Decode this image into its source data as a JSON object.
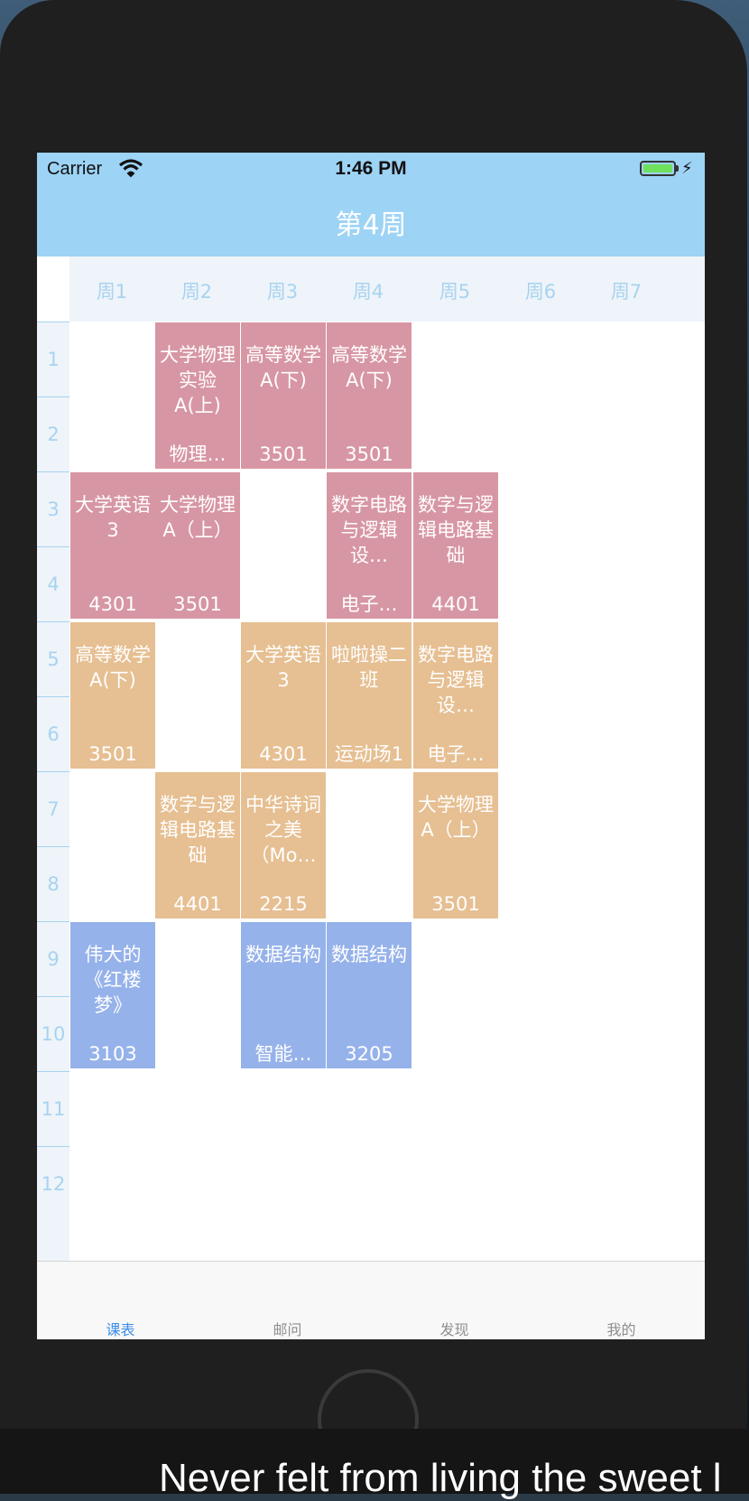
{
  "status_bar": {
    "carrier": "Carrier",
    "time": "1:46 PM"
  },
  "header": {
    "title": "第4周"
  },
  "days": [
    "周1",
    "周2",
    "周3",
    "周4",
    "周5",
    "周6",
    "周7"
  ],
  "periods": [
    "1",
    "2",
    "3",
    "4",
    "5",
    "6",
    "7",
    "8",
    "9",
    "10",
    "11",
    "12"
  ],
  "courses": [
    {
      "name": "大学物理实验A(上)",
      "room": "物理…",
      "day": 2,
      "start": 1,
      "span": 2,
      "color": "pink"
    },
    {
      "name": "高等数学A(下)",
      "room": "3501",
      "day": 3,
      "start": 1,
      "span": 2,
      "color": "pink"
    },
    {
      "name": "高等数学A(下)",
      "room": "3501",
      "day": 4,
      "start": 1,
      "span": 2,
      "color": "pink"
    },
    {
      "name": "大学英语3",
      "room": "4301",
      "day": 1,
      "start": 3,
      "span": 2,
      "color": "pink"
    },
    {
      "name": "大学物理A（上）",
      "room": "3501",
      "day": 2,
      "start": 3,
      "span": 2,
      "color": "pink"
    },
    {
      "name": "数字电路与逻辑设…",
      "room": "电子…",
      "day": 4,
      "start": 3,
      "span": 2,
      "color": "pink"
    },
    {
      "name": "数字与逻辑电路基础",
      "room": "4401",
      "day": 5,
      "start": 3,
      "span": 2,
      "color": "pink"
    },
    {
      "name": "高等数学A(下)",
      "room": "3501",
      "day": 1,
      "start": 5,
      "span": 2,
      "color": "orange"
    },
    {
      "name": "大学英语3",
      "room": "4301",
      "day": 3,
      "start": 5,
      "span": 2,
      "color": "orange"
    },
    {
      "name": "啦啦操二班",
      "room": "运动场1",
      "day": 4,
      "start": 5,
      "span": 2,
      "color": "orange"
    },
    {
      "name": "数字电路与逻辑设…",
      "room": "电子…",
      "day": 5,
      "start": 5,
      "span": 2,
      "color": "orange"
    },
    {
      "name": "数字与逻辑电路基础",
      "room": "4401",
      "day": 2,
      "start": 7,
      "span": 2,
      "color": "orange"
    },
    {
      "name": "中华诗词之美（Mo…",
      "room": "2215",
      "day": 3,
      "start": 7,
      "span": 2,
      "color": "orange"
    },
    {
      "name": "大学物理A（上）",
      "room": "3501",
      "day": 5,
      "start": 7,
      "span": 2,
      "color": "orange"
    },
    {
      "name": "伟大的《红楼梦》",
      "room": "3103",
      "day": 1,
      "start": 9,
      "span": 2,
      "color": "blue"
    },
    {
      "name": "数据结构",
      "room": "智能…",
      "day": 3,
      "start": 9,
      "span": 2,
      "color": "blue"
    },
    {
      "name": "数据结构",
      "room": "3205",
      "day": 4,
      "start": 9,
      "span": 2,
      "color": "blue"
    }
  ],
  "tabbar": [
    {
      "label": "课表",
      "active": true
    },
    {
      "label": "邮问",
      "active": false
    },
    {
      "label": "发现",
      "active": false
    },
    {
      "label": "我的",
      "active": false
    }
  ],
  "caption": "Never felt from living the sweet l"
}
